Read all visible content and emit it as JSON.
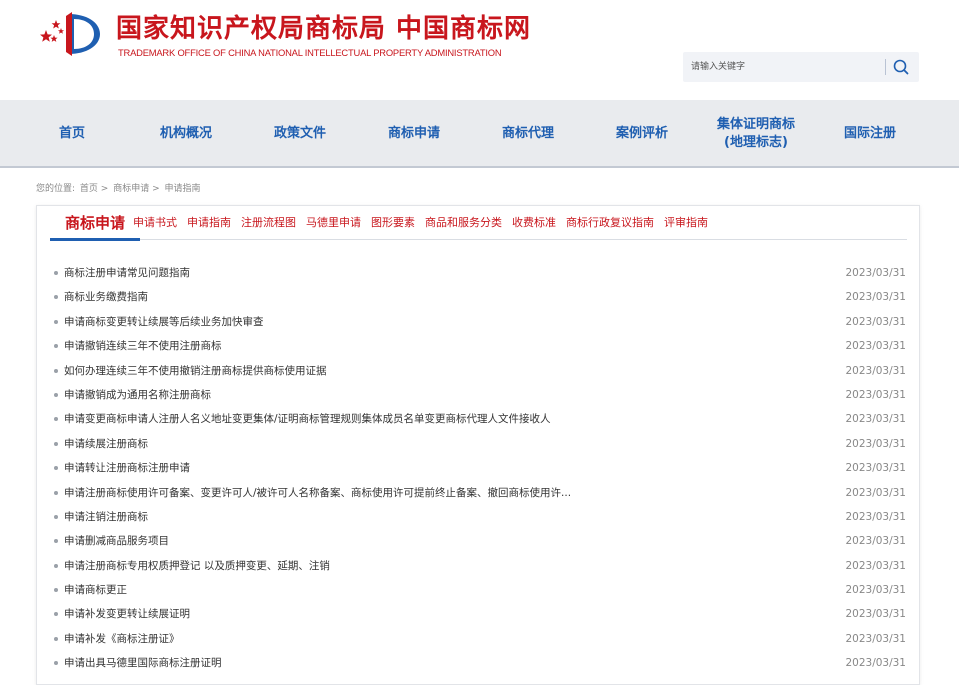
{
  "header": {
    "title": "国家知识产权局商标局 中国商标网",
    "subtitle": "TRADEMARK OFFICE OF CHINA NATIONAL INTELLECTUAL PROPERTY ADMINISTRATION",
    "search_placeholder": "请输入关键字",
    "brand_color": "#c8161d"
  },
  "nav": {
    "items": [
      {
        "label": "首页"
      },
      {
        "label": "机构概况"
      },
      {
        "label": "政策文件"
      },
      {
        "label": "商标申请"
      },
      {
        "label": "商标代理"
      },
      {
        "label": "案例评析"
      },
      {
        "label": "集体证明商标\n(地理标志)"
      },
      {
        "label": "国际注册"
      }
    ],
    "color": "#1f5fb1"
  },
  "breadcrumb": {
    "prefix": "您的位置:",
    "items": [
      "首页 >",
      "商标申请 >",
      "申请指南"
    ]
  },
  "tabs": {
    "main": "商标申请",
    "items": [
      "申请书式",
      "申请指南",
      "注册流程图",
      "马德里申请",
      "图形要素",
      "商品和服务分类",
      "收费标准",
      "商标行政复议指南",
      "评审指南"
    ]
  },
  "list": [
    {
      "title": "商标注册申请常见问题指南",
      "date": "2023/03/31"
    },
    {
      "title": "商标业务缴费指南",
      "date": "2023/03/31"
    },
    {
      "title": "申请商标变更转让续展等后续业务加快审查",
      "date": "2023/03/31"
    },
    {
      "title": "申请撤销连续三年不使用注册商标",
      "date": "2023/03/31"
    },
    {
      "title": "如何办理连续三年不使用撤销注册商标提供商标使用证据",
      "date": "2023/03/31"
    },
    {
      "title": "申请撤销成为通用名称注册商标",
      "date": "2023/03/31"
    },
    {
      "title": "申请变更商标申请人注册人名义地址变更集体/证明商标管理规则集体成员名单变更商标代理人文件接收人",
      "date": "2023/03/31"
    },
    {
      "title": "申请续展注册商标",
      "date": "2023/03/31"
    },
    {
      "title": "申请转让注册商标注册申请",
      "date": "2023/03/31"
    },
    {
      "title": "申请注册商标使用许可备案、变更许可人/被许可人名称备案、商标使用许可提前终止备案、撤回商标使用许...",
      "date": "2023/03/31"
    },
    {
      "title": "申请注销注册商标",
      "date": "2023/03/31"
    },
    {
      "title": "申请删减商品服务项目",
      "date": "2023/03/31"
    },
    {
      "title": "申请注册商标专用权质押登记 以及质押变更、延期、注销",
      "date": "2023/03/31"
    },
    {
      "title": "申请商标更正",
      "date": "2023/03/31"
    },
    {
      "title": "申请补发变更转让续展证明",
      "date": "2023/03/31"
    },
    {
      "title": "申请补发《商标注册证》",
      "date": "2023/03/31"
    },
    {
      "title": "申请出具马德里国际商标注册证明",
      "date": "2023/03/31"
    }
  ]
}
